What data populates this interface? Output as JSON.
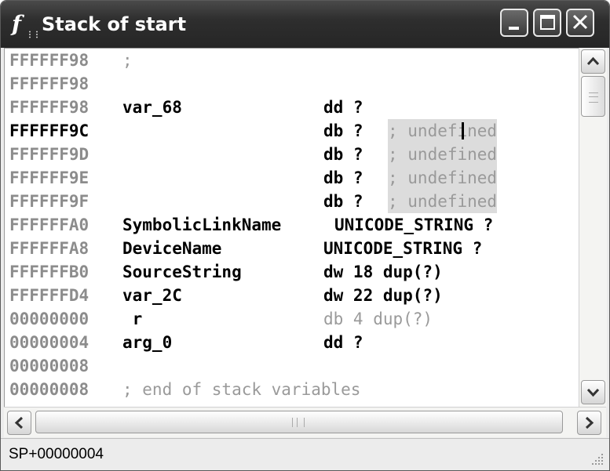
{
  "window": {
    "title": "Stack of start",
    "app_icon": "f-function-icon"
  },
  "stack_rows": [
    {
      "addr": "FFFFFF98",
      "name": "",
      "type": "",
      "comment": ";"
    },
    {
      "addr": "FFFFFF98",
      "name": "",
      "type": "",
      "comment": ""
    },
    {
      "addr": "FFFFFF98",
      "name": "var_68",
      "type": "dd ?",
      "comment": ""
    },
    {
      "addr": "FFFFFF9C",
      "name": "",
      "type": "db ?",
      "comment": "; undefined"
    },
    {
      "addr": "FFFFFF9D",
      "name": "",
      "type": "db ?",
      "comment": "; undefined"
    },
    {
      "addr": "FFFFFF9E",
      "name": "",
      "type": "db ?",
      "comment": "; undefined"
    },
    {
      "addr": "FFFFFF9F",
      "name": "",
      "type": "db ?",
      "comment": "; undefined"
    },
    {
      "addr": "FFFFFFA0",
      "name": "SymbolicLinkName",
      "type": "UNICODE_STRING ?",
      "comment": ""
    },
    {
      "addr": "FFFFFFA8",
      "name": "DeviceName",
      "type": "UNICODE_STRING ?",
      "comment": ""
    },
    {
      "addr": "FFFFFFB0",
      "name": "SourceString",
      "type": "dw 18 dup(?)",
      "comment": ""
    },
    {
      "addr": "FFFFFFD4",
      "name": "var_2C",
      "type": "dw 22 dup(?)",
      "comment": ""
    },
    {
      "addr": "00000000",
      "name": " r",
      "type": "db 4 dup(?)",
      "comment": ""
    },
    {
      "addr": "00000004",
      "name": "arg_0",
      "type": "dd ?",
      "comment": ""
    },
    {
      "addr": "00000008",
      "name": "",
      "type": "",
      "comment": ""
    },
    {
      "addr": "00000008",
      "name": "",
      "type": "",
      "comment": "; end of stack variables"
    }
  ],
  "status": {
    "text": "SP+00000004"
  },
  "colors": {
    "titlebar": "#2e2e2e",
    "dim_text": "#9a9a9a",
    "highlight": "#dcdcdc"
  }
}
